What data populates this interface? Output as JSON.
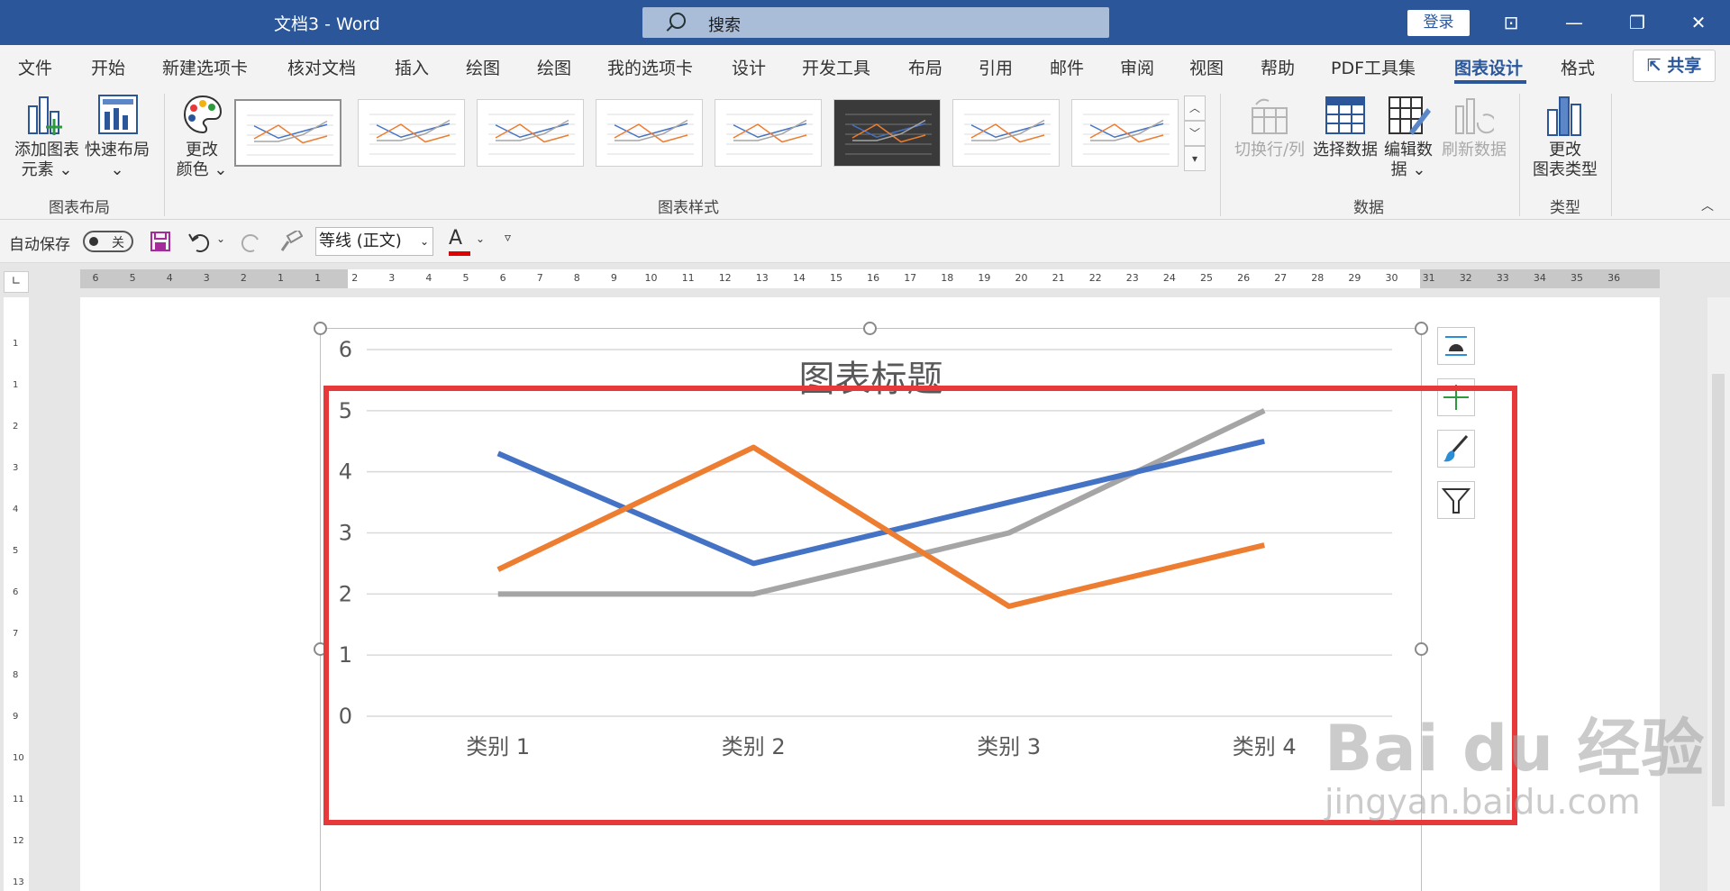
{
  "window": {
    "title": "文档3  -  Word",
    "search_text": "搜索",
    "login": "登录"
  },
  "menu": {
    "items": [
      "文件",
      "开始",
      "新建选项卡",
      "核对文档",
      "插入",
      "绘图",
      "绘图",
      "我的选项卡",
      "设计",
      "开发工具",
      "布局",
      "引用",
      "邮件",
      "审阅",
      "视图",
      "帮助",
      "PDF工具集",
      "图表设计",
      "格式"
    ],
    "active": "图表设计",
    "share": "共享"
  },
  "ribbon": {
    "add_element": [
      "添加图表",
      "元素 ⌄"
    ],
    "quick_layout": [
      "快速布局",
      "⌄"
    ],
    "change_colors": [
      "更改",
      "颜色 ⌄"
    ],
    "switch_row_col": "切换行/列",
    "select_data": "选择数据",
    "edit_data": [
      "编辑数",
      "据 ⌄"
    ],
    "refresh_data": "刷新数据",
    "change_type": [
      "更改",
      "图表类型"
    ],
    "groups": {
      "layout": "图表布局",
      "styles": "图表样式",
      "data": "数据",
      "type": "类型"
    }
  },
  "qat": {
    "autosave_label": "自动保存",
    "autosave_state": "关",
    "font_name": "等线 (正文)",
    "font_color": "#e00000"
  },
  "ruler": {
    "h_numbers": [
      "6",
      "5",
      "4",
      "3",
      "2",
      "1",
      "1",
      "2",
      "3",
      "4",
      "5",
      "6",
      "7",
      "8",
      "9",
      "10",
      "11",
      "12",
      "13",
      "14",
      "15",
      "16",
      "17",
      "18",
      "19",
      "20",
      "21",
      "22",
      "23",
      "24",
      "25",
      "26",
      "27",
      "28",
      "29",
      "30",
      "31",
      "32",
      "33",
      "34",
      "35",
      "36"
    ],
    "v_numbers": [
      "1",
      "1",
      "2",
      "3",
      "4",
      "5",
      "6",
      "7",
      "8",
      "9",
      "10",
      "11",
      "12",
      "13"
    ]
  },
  "chart": {
    "title": "图表标题"
  },
  "watermark": {
    "brand": "Bai du 经验",
    "url": "jingyan.baidu.com"
  },
  "chart_data": {
    "type": "line",
    "title": "图表标题",
    "categories": [
      "类别 1",
      "类别 2",
      "类别 3",
      "类别 4"
    ],
    "series": [
      {
        "values": [
          4.3,
          2.5,
          3.5,
          4.5
        ],
        "color": "#4472c4"
      },
      {
        "values": [
          2.4,
          4.4,
          1.8,
          2.8
        ],
        "color": "#ed7d31"
      },
      {
        "values": [
          2.0,
          2.0,
          3.0,
          5.0
        ],
        "color": "#a5a5a5"
      }
    ],
    "yticks": [
      "0",
      "1",
      "2",
      "3",
      "4",
      "5",
      "6"
    ],
    "ylim": [
      0,
      6
    ],
    "grid": true
  }
}
